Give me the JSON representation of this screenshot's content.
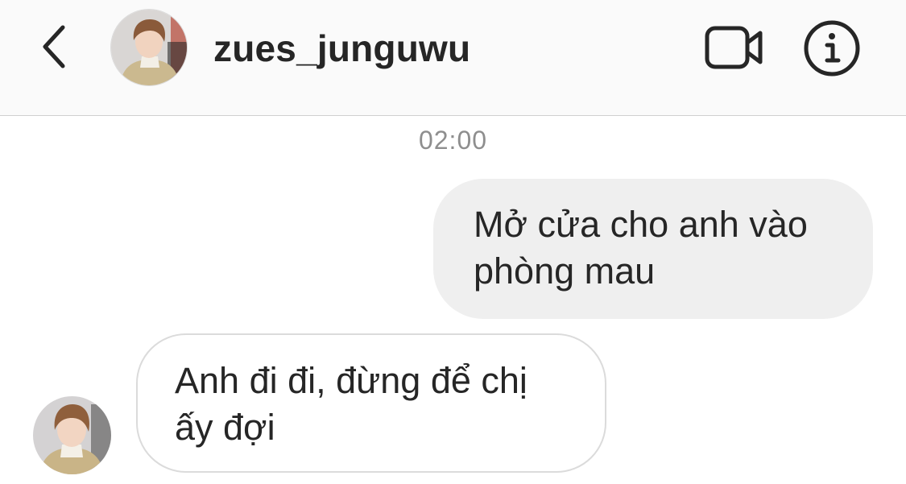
{
  "header": {
    "username": "zues_junguwu",
    "back_icon": "chevron-left-icon",
    "video_icon": "video-camera-icon",
    "info_icon": "info-icon"
  },
  "conversation": {
    "timestamp": "02:00",
    "messages": [
      {
        "direction": "sent",
        "text": "Mở cửa cho anh vào\nphòng mau"
      },
      {
        "direction": "received",
        "text": "Anh đi đi, đừng để chị\nấy đợi"
      }
    ]
  },
  "colors": {
    "header_bg": "#fafafa",
    "sent_bubble_bg": "#efefef",
    "received_bubble_border": "#dbdbdb",
    "timestamp": "#8e8e8e",
    "text": "#262626"
  }
}
